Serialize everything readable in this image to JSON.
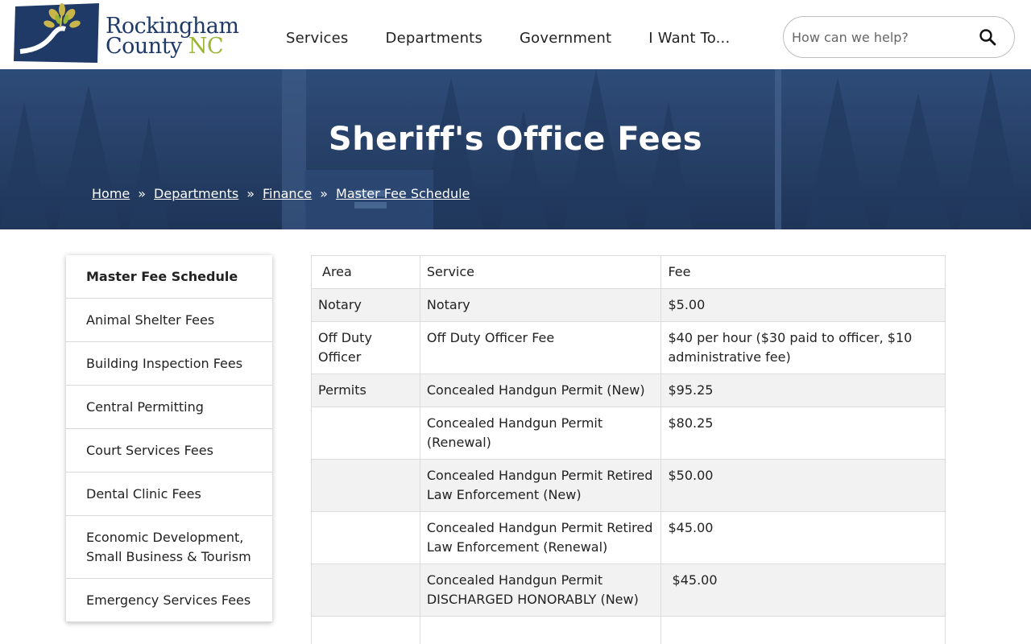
{
  "header": {
    "logo": {
      "line1": "Rockingham",
      "line2": "County",
      "suffix": "NC"
    },
    "nav": [
      "Services",
      "Departments",
      "Government",
      "I Want To..."
    ],
    "search": {
      "placeholder": "How can we help?"
    }
  },
  "hero": {
    "title": "Sheriff's Office Fees",
    "breadcrumb": [
      "Home",
      "Departments",
      "Finance",
      "Master Fee Schedule"
    ],
    "separator": "»"
  },
  "sidebar": {
    "items": [
      "Master Fee Schedule",
      "Animal Shelter Fees",
      "Building Inspection Fees",
      "Central Permitting",
      "Court Services Fees",
      "Dental Clinic Fees",
      "Economic Development, Small Business & Tourism",
      "Emergency Services Fees"
    ]
  },
  "table": {
    "headers": [
      "Area",
      "Service",
      "Fee"
    ],
    "rows": [
      [
        "Notary",
        "Notary",
        "$5.00"
      ],
      [
        "Off Duty Officer",
        "Off Duty Officer Fee",
        "$40 per hour ($30 paid to officer, $10 administrative fee)"
      ],
      [
        "Permits",
        "Concealed Handgun Permit (New)",
        "$95.25"
      ],
      [
        "",
        "Concealed Handgun Permit (Renewal)",
        "$80.25"
      ],
      [
        "",
        "Concealed Handgun Permit Retired Law Enforcement (New)",
        "$50.00"
      ],
      [
        "",
        "Concealed Handgun Permit Retired Law Enforcement (Renewal)",
        "$45.00"
      ],
      [
        "",
        "Concealed Handgun Permit DISCHARGED HONORABLY (New)",
        " $45.00"
      ]
    ]
  },
  "colors": {
    "brand_navy": "#1f3a67",
    "brand_green": "#9ab534",
    "hero_overlay": "#263f66",
    "row_alt": "#f2f2f2"
  }
}
